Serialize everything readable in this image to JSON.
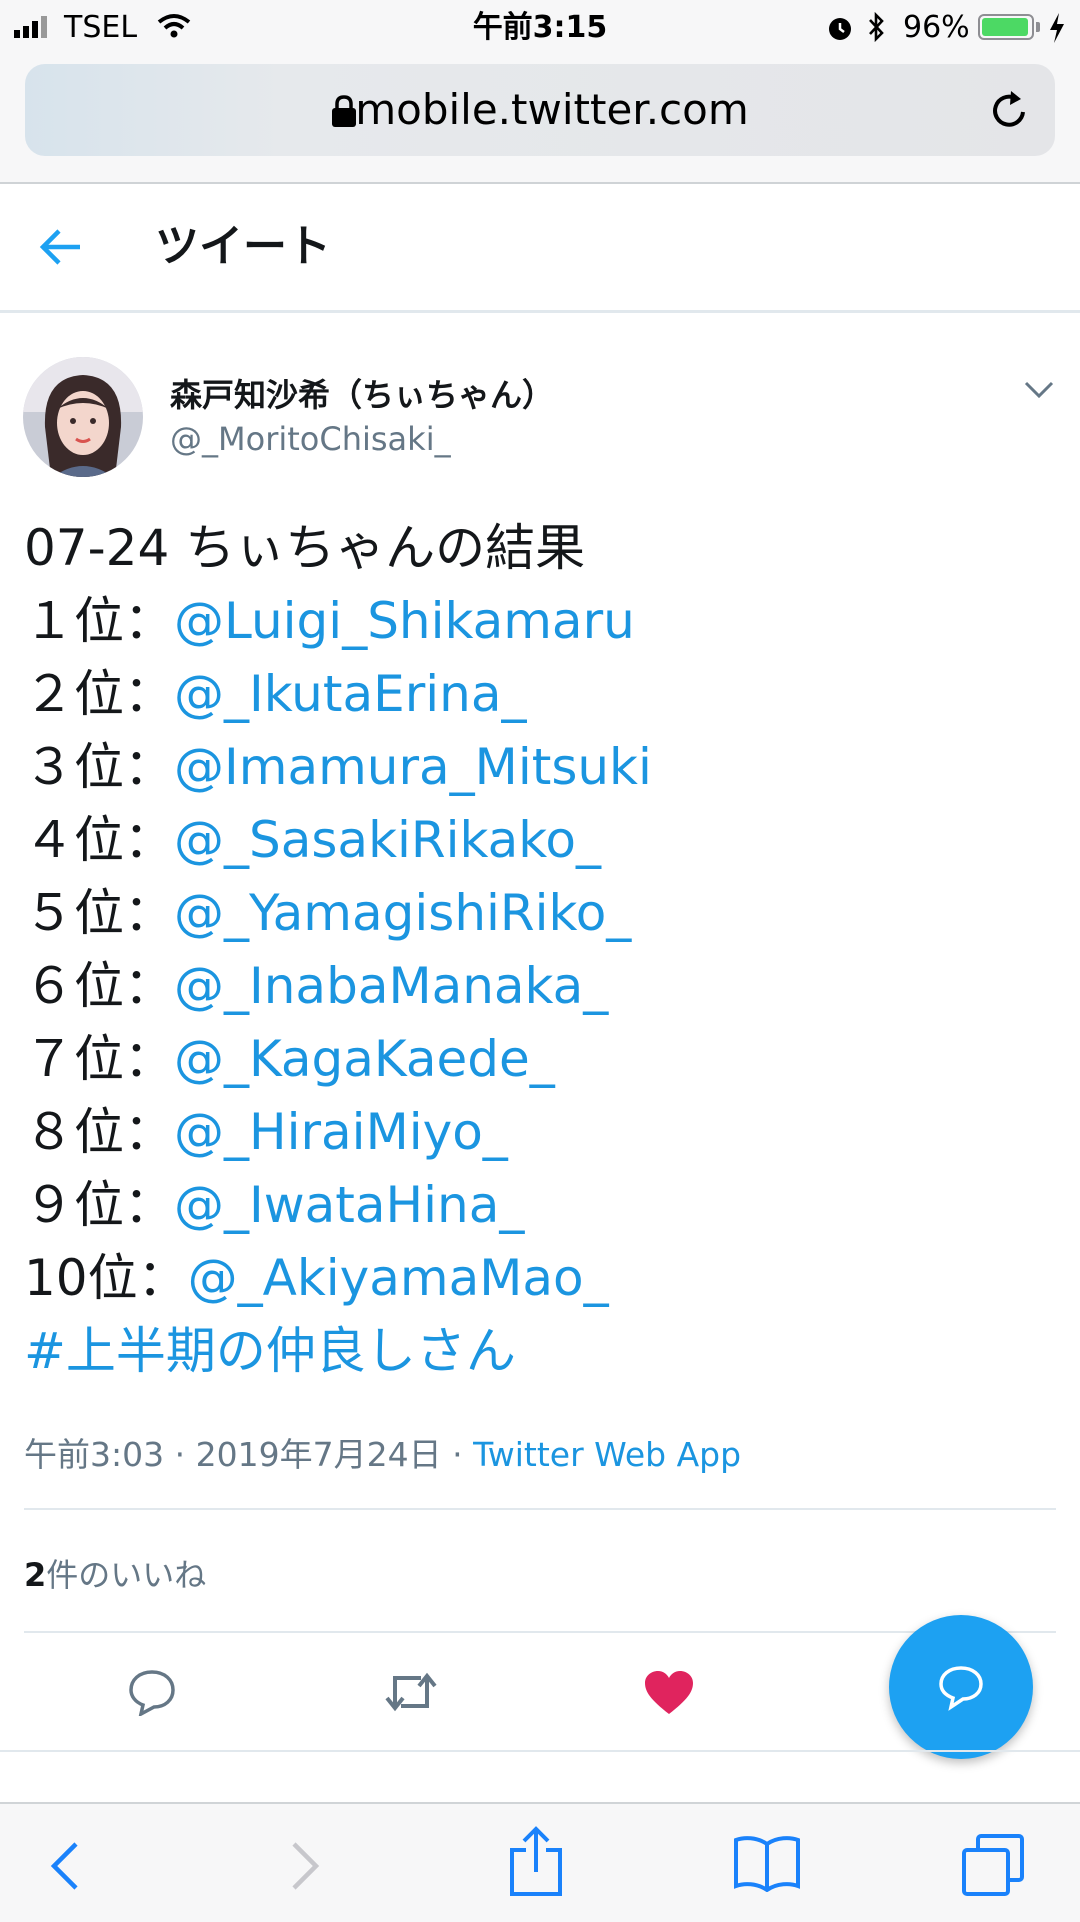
{
  "status_bar": {
    "carrier": "TSEL",
    "time": "午前3:15",
    "battery_percent": "96%",
    "battery_level": 0.96
  },
  "browser": {
    "url": "mobile.twitter.com"
  },
  "header": {
    "title": "ツイート"
  },
  "tweet": {
    "display_name": "森戸知沙希（ちぃちゃん）",
    "handle": "@_MoritoChisaki_",
    "intro": "07-24 ちぃちゃんの結果",
    "ranks": [
      {
        "rank": "１位：",
        "mention": "@Luigi_Shikamaru"
      },
      {
        "rank": "２位：",
        "mention": "@_IkutaErina_"
      },
      {
        "rank": "３位：",
        "mention": "@Imamura_Mitsuki"
      },
      {
        "rank": "４位：",
        "mention": "@_SasakiRikako_"
      },
      {
        "rank": "５位：",
        "mention": "@_YamagishiRiko_"
      },
      {
        "rank": "６位：",
        "mention": "@_InabaManaka_"
      },
      {
        "rank": "７位：",
        "mention": "@_KagaKaede_"
      },
      {
        "rank": "８位：",
        "mention": "@_HiraiMiyo_"
      },
      {
        "rank": "９位：",
        "mention": "@_IwataHina_"
      },
      {
        "rank": "10位：",
        "mention": "@_AkiyamaMao_"
      }
    ],
    "hashtag": "#上半期の仲良しさん",
    "time": "午前3:03",
    "date": "2019年7月24日",
    "source": "Twitter Web App",
    "likes_count": "2",
    "likes_unit": "件の",
    "likes_label": "いいね"
  },
  "colors": {
    "accent": "#1da1f2",
    "link": "#1b95e0",
    "like": "#e0245e",
    "battery": "#4cd964"
  },
  "icons": [
    "back-arrow-icon",
    "lock-icon",
    "reload-icon",
    "chevron-down-icon",
    "reply-icon",
    "retweet-icon",
    "heart-icon",
    "compose-icon",
    "safari-back-icon",
    "safari-forward-icon",
    "share-icon",
    "bookmarks-icon",
    "tabs-icon"
  ]
}
